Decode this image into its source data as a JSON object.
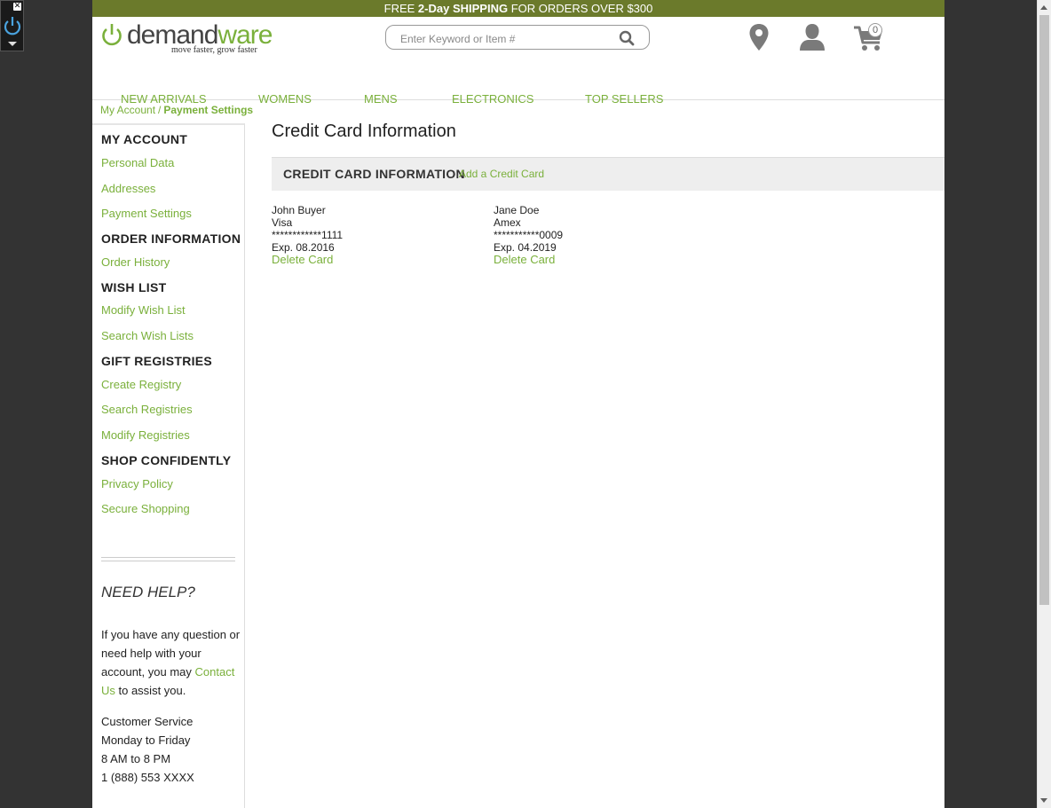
{
  "promo": {
    "prefix": "FREE",
    "bold": "2-Day SHIPPING",
    "suffix": "FOR ORDERS OVER $300"
  },
  "logo": {
    "word_demand": "demand",
    "word_ware": "ware",
    "tagline": "move faster, grow faster"
  },
  "search": {
    "placeholder": "Enter Keyword or Item #"
  },
  "cart": {
    "count": "0"
  },
  "nav": [
    "NEW ARRIVALS",
    "WOMENS",
    "MENS",
    "ELECTRONICS",
    "TOP SELLERS"
  ],
  "breadcrumb": {
    "parent": "My Account",
    "separator": "/",
    "current": "Payment Settings"
  },
  "sidebar": {
    "my_account": "MY ACCOUNT",
    "personal_data": "Personal Data",
    "addresses": "Addresses",
    "payment_settings": "Payment Settings",
    "order_information": "ORDER INFORMATION",
    "order_history": "Order History",
    "wish_list": "WISH LIST",
    "modify_wish_list": "Modify Wish List",
    "search_wish_lists": "Search Wish Lists",
    "gift_registries": "GIFT REGISTRIES",
    "create_registry": "Create Registry",
    "search_registries": "Search Registries",
    "modify_registries": "Modify Registries",
    "shop_confidently": "SHOP CONFIDENTLY",
    "privacy_policy": "Privacy Policy",
    "secure_shopping": "Secure Shopping"
  },
  "help": {
    "title": "NEED HELP?",
    "text_before": "If you have any question or need help with your account, you may ",
    "contact_link": "Contact Us",
    "text_after": " to assist you.",
    "cs_title": "Customer Service",
    "cs_days": "Monday to Friday",
    "cs_hours": "8 AM to 8 PM",
    "cs_phone": "1 (888) 553 XXXX"
  },
  "main": {
    "title": "Credit Card Information",
    "bar_title": "CREDIT CARD INFORMATION",
    "add_link": "Add a Credit Card"
  },
  "cards": [
    {
      "name": "John Buyer",
      "type": "Visa",
      "number": "************1111",
      "exp": "Exp. 08.2016",
      "delete": "Delete Card"
    },
    {
      "name": "Jane Doe",
      "type": "Amex",
      "number": "***********0009",
      "exp": "Exp. 04.2019",
      "delete": "Delete Card"
    }
  ],
  "colors": {
    "brand_green": "#7ab03b",
    "promo_bar": "#6b7a2b",
    "gutter": "#333333"
  }
}
